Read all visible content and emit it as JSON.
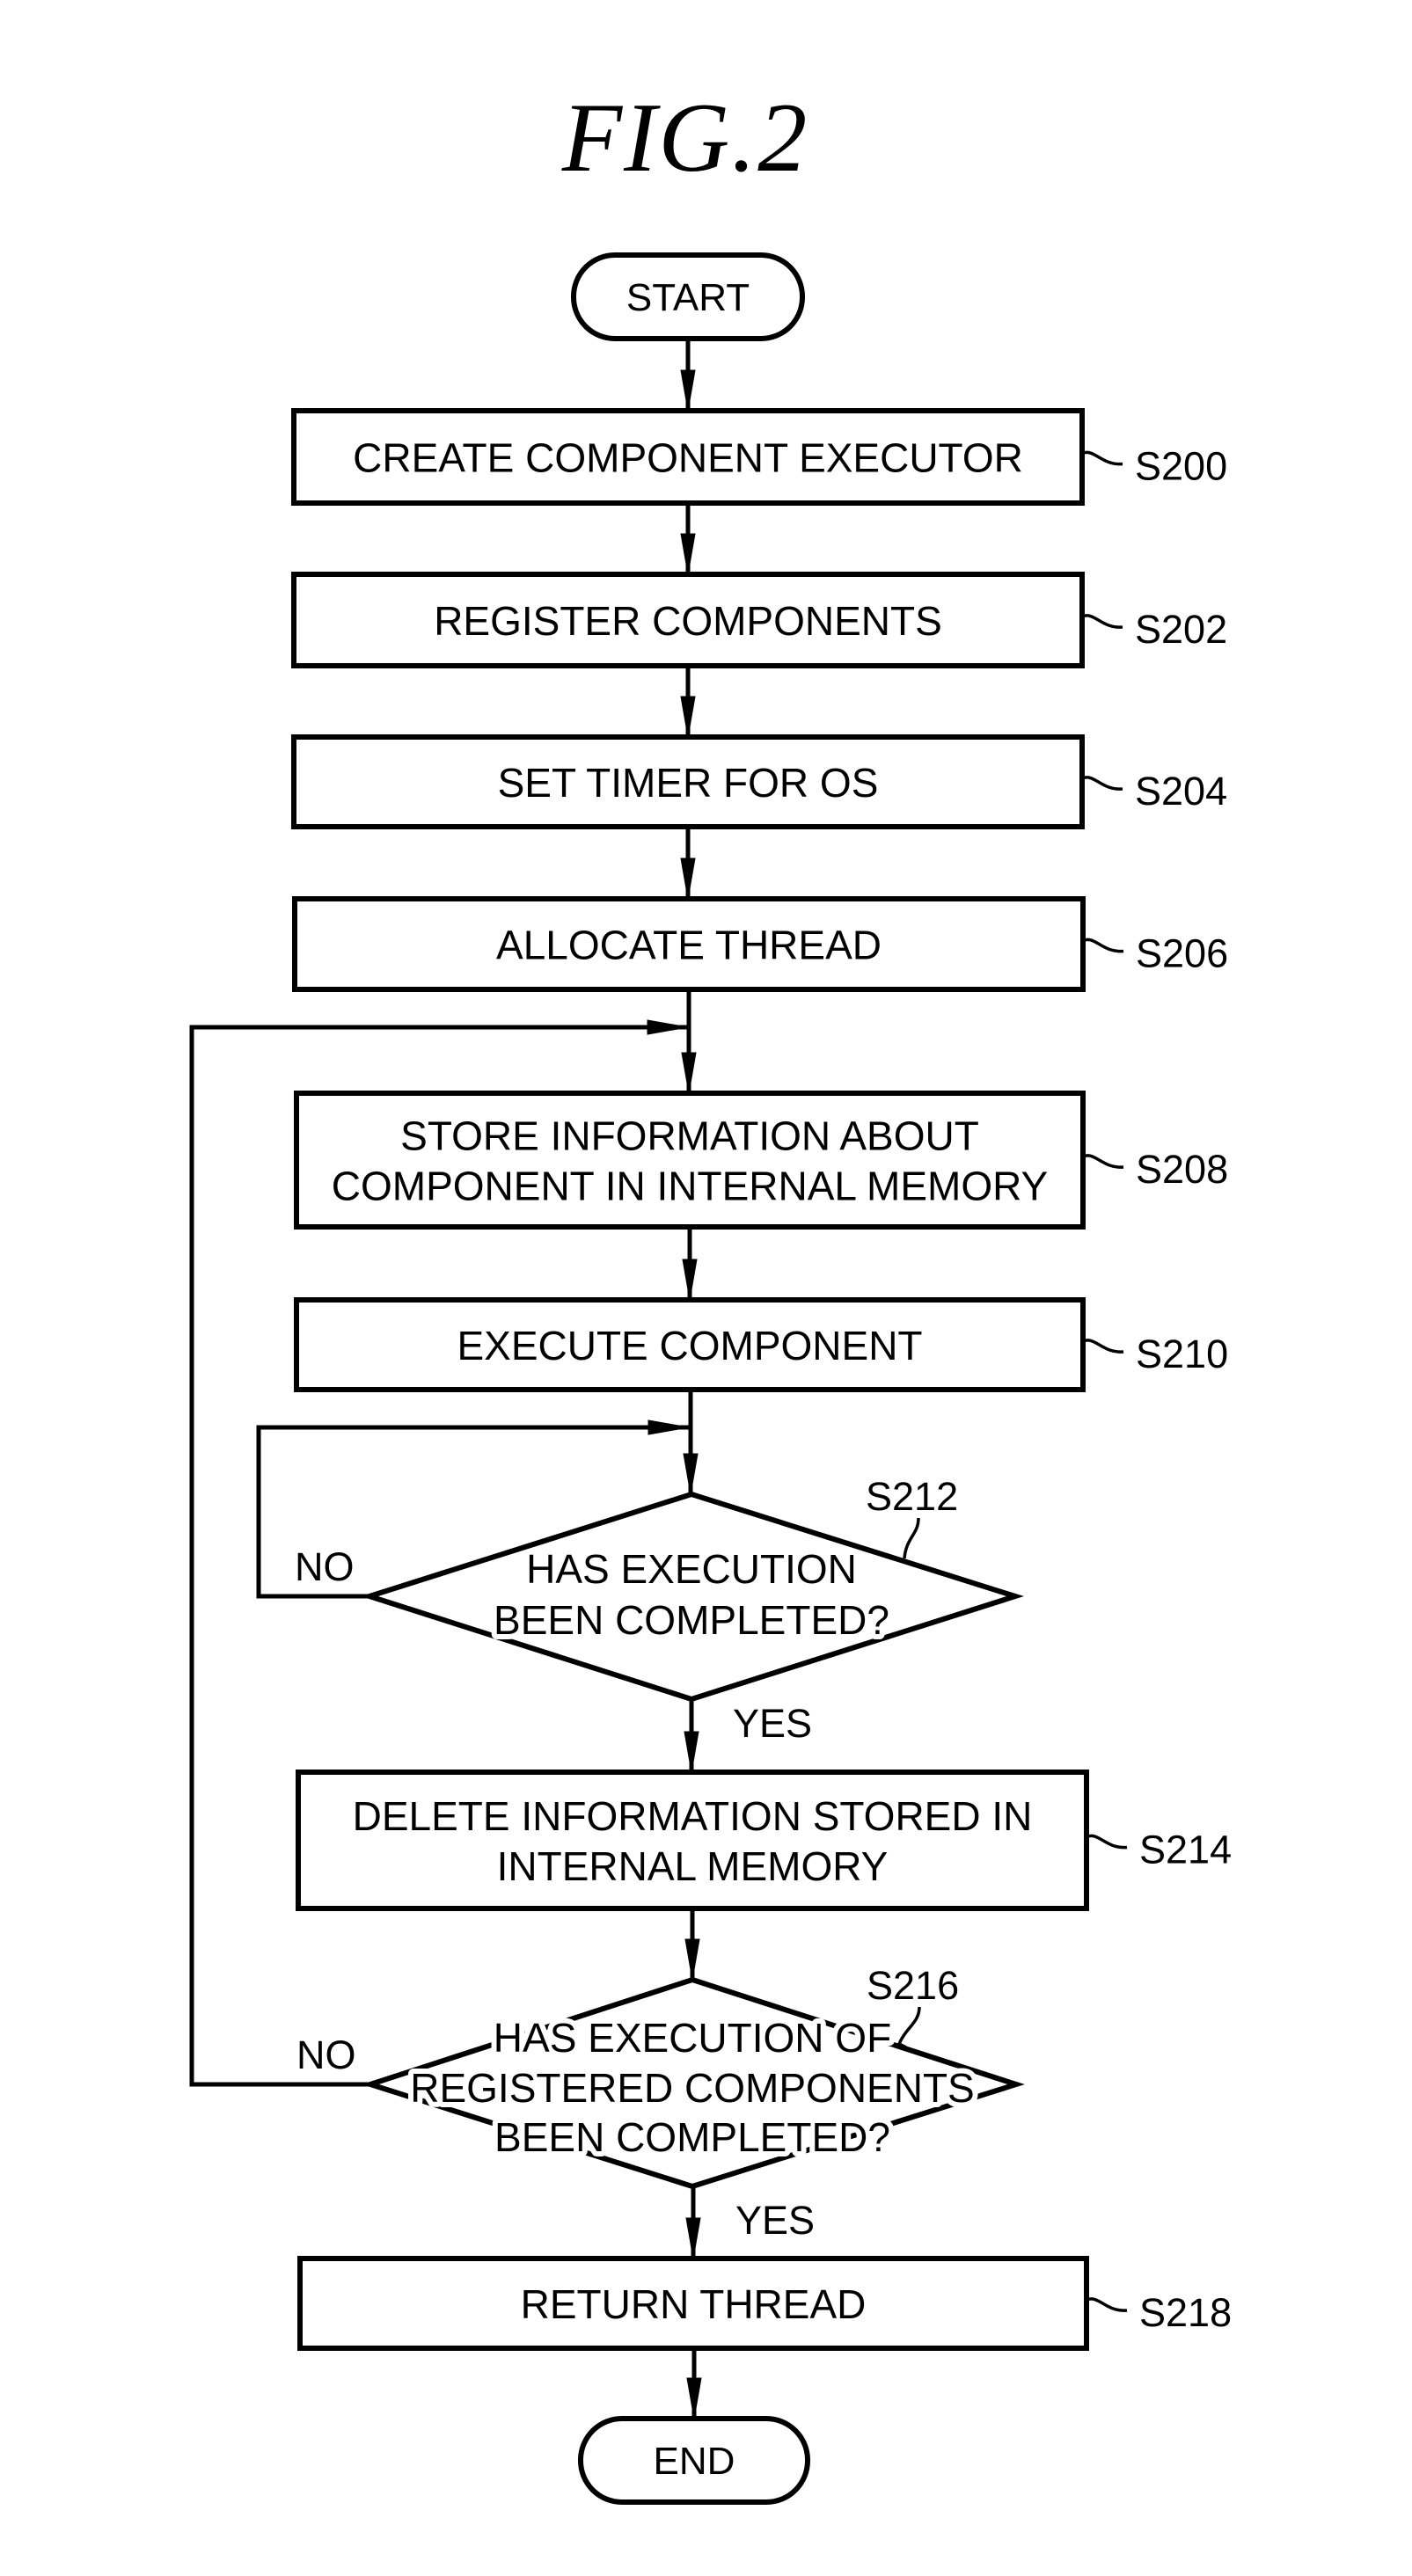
{
  "figure": {
    "title": "FIG.2"
  },
  "flowchart": {
    "start": {
      "label": "START"
    },
    "end": {
      "label": "END"
    },
    "steps": [
      {
        "id": "S200",
        "label_lines": [
          "CREATE COMPONENT EXECUTOR"
        ]
      },
      {
        "id": "S202",
        "label_lines": [
          "REGISTER COMPONENTS"
        ]
      },
      {
        "id": "S204",
        "label_lines": [
          "SET TIMER FOR OS"
        ]
      },
      {
        "id": "S206",
        "label_lines": [
          "ALLOCATE THREAD"
        ]
      },
      {
        "id": "S208",
        "label_lines": [
          "STORE INFORMATION ABOUT",
          "COMPONENT IN INTERNAL MEMORY"
        ]
      },
      {
        "id": "S210",
        "label_lines": [
          "EXECUTE COMPONENT"
        ]
      },
      {
        "id": "S214",
        "label_lines": [
          "DELETE INFORMATION STORED IN",
          "INTERNAL MEMORY"
        ]
      },
      {
        "id": "S218",
        "label_lines": [
          "RETURN THREAD"
        ]
      }
    ],
    "decisions": [
      {
        "id": "S212",
        "label_lines": [
          "HAS EXECUTION",
          "BEEN COMPLETED?"
        ],
        "yes_label": "YES",
        "no_label": "NO"
      },
      {
        "id": "S216",
        "label_lines": [
          "HAS EXECUTION OF",
          "REGISTERED COMPONENTS",
          "BEEN COMPLETED?"
        ],
        "yes_label": "YES",
        "no_label": "NO"
      }
    ]
  }
}
